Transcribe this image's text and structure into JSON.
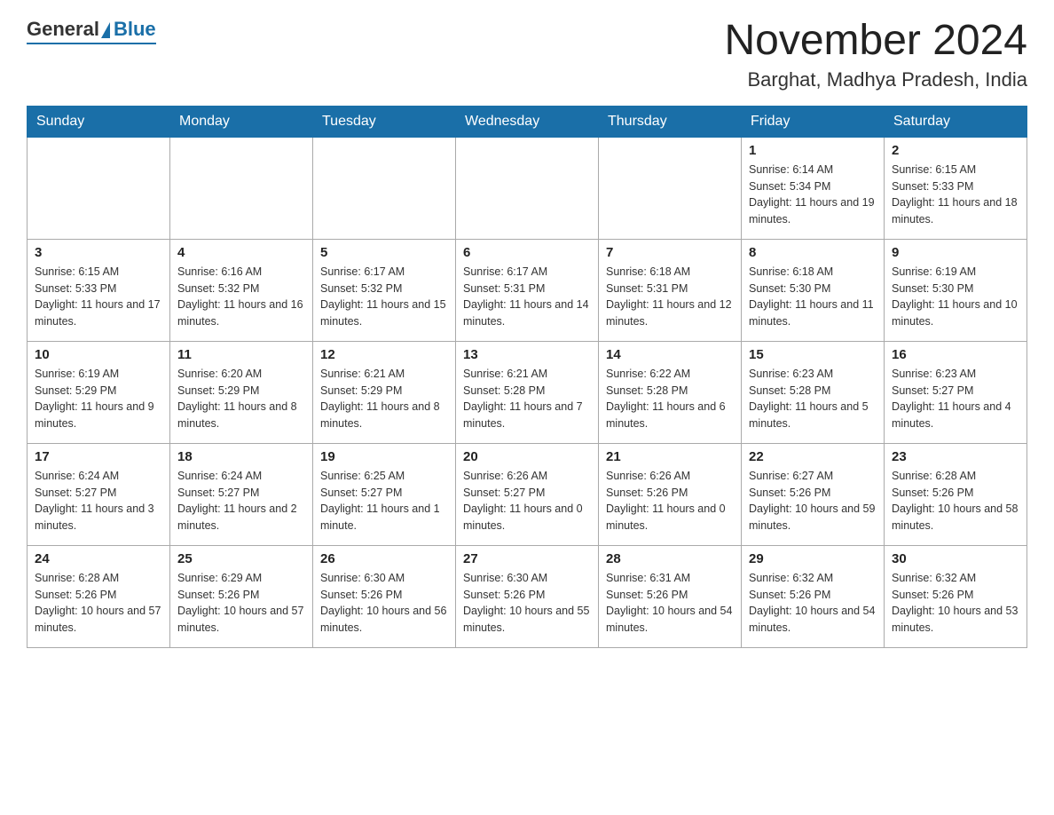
{
  "logo": {
    "general": "General",
    "blue": "Blue"
  },
  "header": {
    "month": "November 2024",
    "location": "Barghat, Madhya Pradesh, India"
  },
  "days_of_week": [
    "Sunday",
    "Monday",
    "Tuesday",
    "Wednesday",
    "Thursday",
    "Friday",
    "Saturday"
  ],
  "weeks": [
    [
      {
        "day": "",
        "info": ""
      },
      {
        "day": "",
        "info": ""
      },
      {
        "day": "",
        "info": ""
      },
      {
        "day": "",
        "info": ""
      },
      {
        "day": "",
        "info": ""
      },
      {
        "day": "1",
        "info": "Sunrise: 6:14 AM\nSunset: 5:34 PM\nDaylight: 11 hours and 19 minutes."
      },
      {
        "day": "2",
        "info": "Sunrise: 6:15 AM\nSunset: 5:33 PM\nDaylight: 11 hours and 18 minutes."
      }
    ],
    [
      {
        "day": "3",
        "info": "Sunrise: 6:15 AM\nSunset: 5:33 PM\nDaylight: 11 hours and 17 minutes."
      },
      {
        "day": "4",
        "info": "Sunrise: 6:16 AM\nSunset: 5:32 PM\nDaylight: 11 hours and 16 minutes."
      },
      {
        "day": "5",
        "info": "Sunrise: 6:17 AM\nSunset: 5:32 PM\nDaylight: 11 hours and 15 minutes."
      },
      {
        "day": "6",
        "info": "Sunrise: 6:17 AM\nSunset: 5:31 PM\nDaylight: 11 hours and 14 minutes."
      },
      {
        "day": "7",
        "info": "Sunrise: 6:18 AM\nSunset: 5:31 PM\nDaylight: 11 hours and 12 minutes."
      },
      {
        "day": "8",
        "info": "Sunrise: 6:18 AM\nSunset: 5:30 PM\nDaylight: 11 hours and 11 minutes."
      },
      {
        "day": "9",
        "info": "Sunrise: 6:19 AM\nSunset: 5:30 PM\nDaylight: 11 hours and 10 minutes."
      }
    ],
    [
      {
        "day": "10",
        "info": "Sunrise: 6:19 AM\nSunset: 5:29 PM\nDaylight: 11 hours and 9 minutes."
      },
      {
        "day": "11",
        "info": "Sunrise: 6:20 AM\nSunset: 5:29 PM\nDaylight: 11 hours and 8 minutes."
      },
      {
        "day": "12",
        "info": "Sunrise: 6:21 AM\nSunset: 5:29 PM\nDaylight: 11 hours and 8 minutes."
      },
      {
        "day": "13",
        "info": "Sunrise: 6:21 AM\nSunset: 5:28 PM\nDaylight: 11 hours and 7 minutes."
      },
      {
        "day": "14",
        "info": "Sunrise: 6:22 AM\nSunset: 5:28 PM\nDaylight: 11 hours and 6 minutes."
      },
      {
        "day": "15",
        "info": "Sunrise: 6:23 AM\nSunset: 5:28 PM\nDaylight: 11 hours and 5 minutes."
      },
      {
        "day": "16",
        "info": "Sunrise: 6:23 AM\nSunset: 5:27 PM\nDaylight: 11 hours and 4 minutes."
      }
    ],
    [
      {
        "day": "17",
        "info": "Sunrise: 6:24 AM\nSunset: 5:27 PM\nDaylight: 11 hours and 3 minutes."
      },
      {
        "day": "18",
        "info": "Sunrise: 6:24 AM\nSunset: 5:27 PM\nDaylight: 11 hours and 2 minutes."
      },
      {
        "day": "19",
        "info": "Sunrise: 6:25 AM\nSunset: 5:27 PM\nDaylight: 11 hours and 1 minute."
      },
      {
        "day": "20",
        "info": "Sunrise: 6:26 AM\nSunset: 5:27 PM\nDaylight: 11 hours and 0 minutes."
      },
      {
        "day": "21",
        "info": "Sunrise: 6:26 AM\nSunset: 5:26 PM\nDaylight: 11 hours and 0 minutes."
      },
      {
        "day": "22",
        "info": "Sunrise: 6:27 AM\nSunset: 5:26 PM\nDaylight: 10 hours and 59 minutes."
      },
      {
        "day": "23",
        "info": "Sunrise: 6:28 AM\nSunset: 5:26 PM\nDaylight: 10 hours and 58 minutes."
      }
    ],
    [
      {
        "day": "24",
        "info": "Sunrise: 6:28 AM\nSunset: 5:26 PM\nDaylight: 10 hours and 57 minutes."
      },
      {
        "day": "25",
        "info": "Sunrise: 6:29 AM\nSunset: 5:26 PM\nDaylight: 10 hours and 57 minutes."
      },
      {
        "day": "26",
        "info": "Sunrise: 6:30 AM\nSunset: 5:26 PM\nDaylight: 10 hours and 56 minutes."
      },
      {
        "day": "27",
        "info": "Sunrise: 6:30 AM\nSunset: 5:26 PM\nDaylight: 10 hours and 55 minutes."
      },
      {
        "day": "28",
        "info": "Sunrise: 6:31 AM\nSunset: 5:26 PM\nDaylight: 10 hours and 54 minutes."
      },
      {
        "day": "29",
        "info": "Sunrise: 6:32 AM\nSunset: 5:26 PM\nDaylight: 10 hours and 54 minutes."
      },
      {
        "day": "30",
        "info": "Sunrise: 6:32 AM\nSunset: 5:26 PM\nDaylight: 10 hours and 53 minutes."
      }
    ]
  ]
}
